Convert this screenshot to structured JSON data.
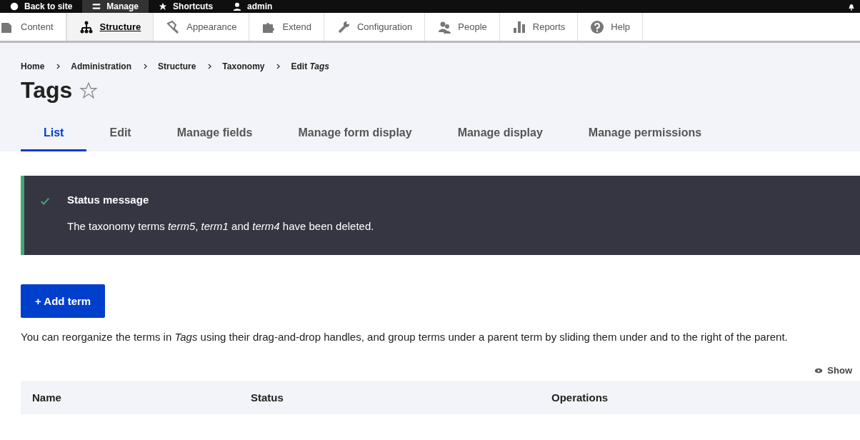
{
  "toolbar": [
    {
      "label": "Back to site",
      "kind": "back",
      "selected": false
    },
    {
      "label": "Manage",
      "kind": "menu",
      "selected": true
    },
    {
      "label": "Shortcuts",
      "kind": "star",
      "selected": false
    },
    {
      "label": "admin",
      "kind": "user",
      "selected": false
    }
  ],
  "admin_menu": [
    {
      "label": "Content",
      "kind": "content",
      "selected": false
    },
    {
      "label": "Structure",
      "kind": "structure",
      "selected": true
    },
    {
      "label": "Appearance",
      "kind": "appearance",
      "selected": false
    },
    {
      "label": "Extend",
      "kind": "extend",
      "selected": false
    },
    {
      "label": "Configuration",
      "kind": "configuration",
      "selected": false
    },
    {
      "label": "People",
      "kind": "people",
      "selected": false
    },
    {
      "label": "Reports",
      "kind": "reports",
      "selected": false
    },
    {
      "label": "Help",
      "kind": "help",
      "selected": false
    }
  ],
  "breadcrumb": [
    "Home",
    "Administration",
    "Structure",
    "Taxonomy",
    "Edit *Tags*"
  ],
  "page_title": "Tags",
  "tabs": [
    {
      "label": "List",
      "selected": true
    },
    {
      "label": "Edit",
      "selected": false
    },
    {
      "label": "Manage fields",
      "selected": false
    },
    {
      "label": "Manage form display",
      "selected": false
    },
    {
      "label": "Manage display",
      "selected": false
    },
    {
      "label": "Manage permissions",
      "selected": false
    }
  ],
  "status_message": {
    "title": "Status message",
    "text": "The taxonomy terms *term5*, *term1* and *term4* have been deleted."
  },
  "add_button": "+ Add term",
  "description": "You can reorganize the terms in *Tags* using their drag-and-drop handles, and group terms under a parent term by sliding them under and to the right of the parent.",
  "show_link": "Show",
  "table": {
    "columns": [
      "Name",
      "Status",
      "Operations"
    ]
  }
}
